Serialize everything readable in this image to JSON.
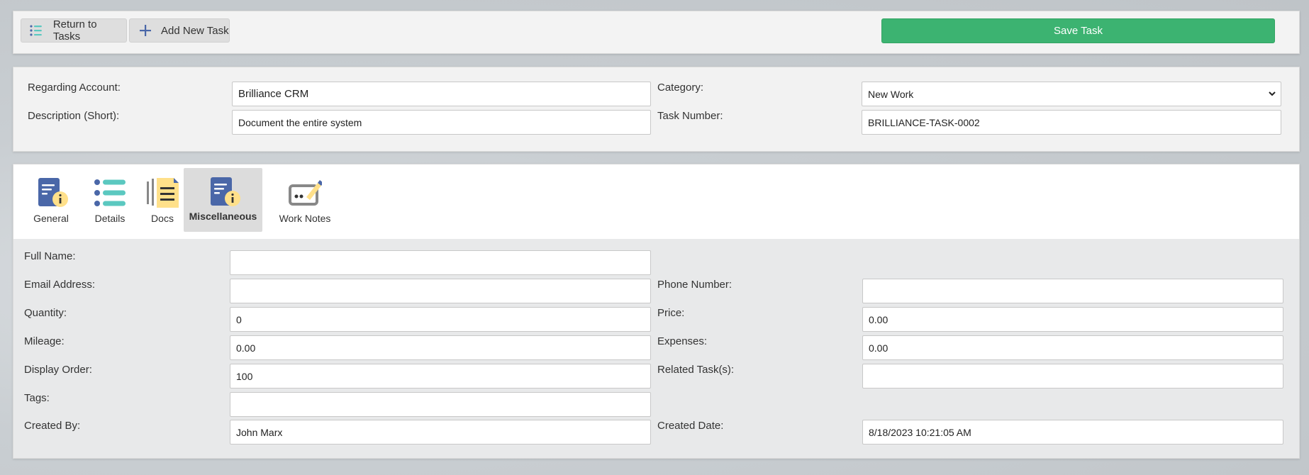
{
  "toolbar": {
    "return_label": "Return to Tasks",
    "add_label": "Add New Task",
    "save_label": "Save Task"
  },
  "header": {
    "regarding_account": {
      "label": "Regarding Account:",
      "value": "Brilliance CRM"
    },
    "category": {
      "label": "Category:",
      "value": "New Work"
    },
    "description": {
      "label": "Description (Short):",
      "value": "Document the entire system"
    },
    "task_number": {
      "label": "Task Number:",
      "value": "BRILLIANCE-TASK-0002"
    }
  },
  "tabs": [
    {
      "label": "General",
      "icon": "document-info-icon"
    },
    {
      "label": "Details",
      "icon": "list-icon"
    },
    {
      "label": "Docs",
      "icon": "notes-icon"
    },
    {
      "label": "Miscellaneous",
      "icon": "document-info-icon",
      "active": true
    },
    {
      "label": "Work Notes",
      "icon": "signature-icon"
    }
  ],
  "fields": {
    "full_name": {
      "label": "Full Name:",
      "value": ""
    },
    "email": {
      "label": "Email Address:",
      "value": ""
    },
    "phone": {
      "label": "Phone Number:",
      "value": ""
    },
    "quantity": {
      "label": "Quantity:",
      "value": "0"
    },
    "price": {
      "label": "Price:",
      "value": "0.00"
    },
    "mileage": {
      "label": "Mileage:",
      "value": "0.00"
    },
    "expenses": {
      "label": "Expenses:",
      "value": "0.00"
    },
    "display_order": {
      "label": "Display Order:",
      "value": "100"
    },
    "related_tasks": {
      "label": "Related Task(s):",
      "value": ""
    },
    "tags": {
      "label": "Tags:",
      "value": ""
    },
    "created_by": {
      "label": "Created By:",
      "value": "John Marx"
    },
    "created_date": {
      "label": "Created Date:",
      "value": "8/18/2023 10:21:05 AM"
    }
  },
  "colors": {
    "save_green": "#3cb371",
    "icon_blue": "#4a67a8",
    "icon_teal": "#5bc8c0",
    "icon_yellow": "#ffe08a"
  }
}
